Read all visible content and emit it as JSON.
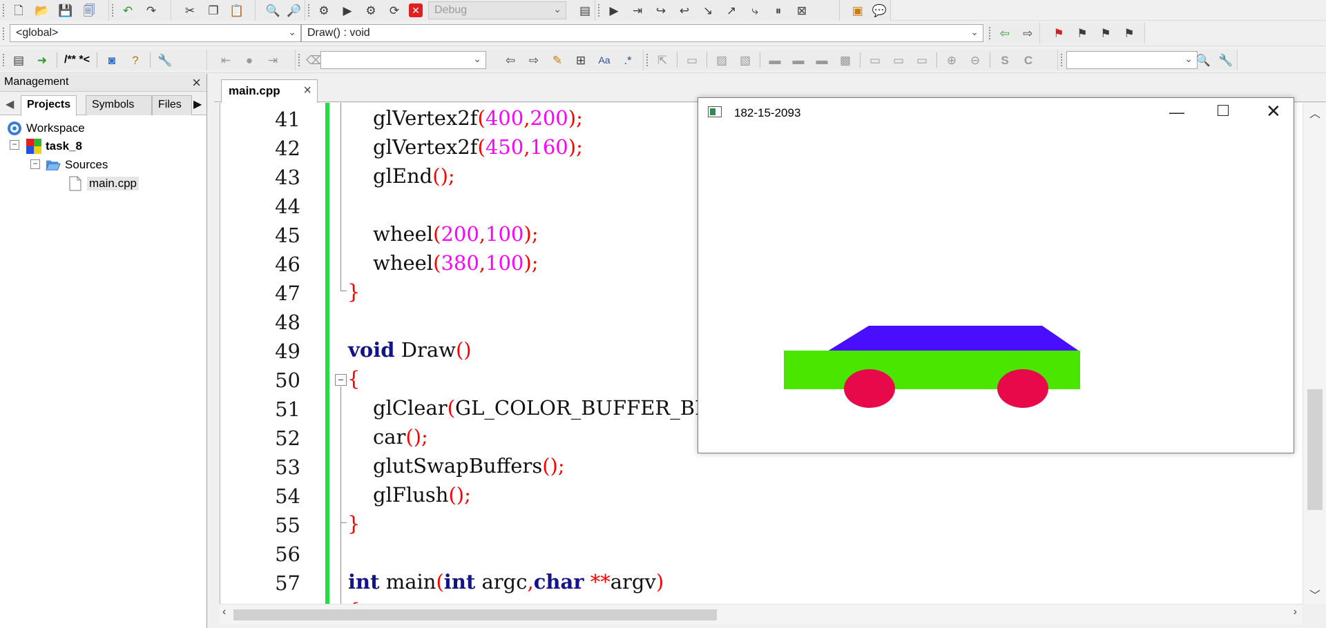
{
  "toolbar1": {
    "build_config": "Debug"
  },
  "toolbar2": {
    "scope": "<global>",
    "function": "Draw() : void"
  },
  "toolbar3": {
    "comment_label": "/** *<",
    "search_value": "",
    "find_value": ""
  },
  "management": {
    "title": "Management",
    "tabs": [
      "Projects",
      "Symbols",
      "Files"
    ],
    "tree": {
      "workspace": "Workspace",
      "project": "task_8",
      "folder": "Sources",
      "file": "main.cpp"
    }
  },
  "editor": {
    "tab_label": "main.cpp",
    "line_numbers": [
      "41",
      "42",
      "43",
      "44",
      "45",
      "46",
      "47",
      "48",
      "49",
      "50",
      "51",
      "52",
      "53",
      "54",
      "55",
      "56",
      "57"
    ]
  },
  "glut_window": {
    "title": "182-15-2093",
    "colors": {
      "roof": "#4a0eff",
      "body": "#4be600",
      "wheels": "#e8094b"
    }
  }
}
